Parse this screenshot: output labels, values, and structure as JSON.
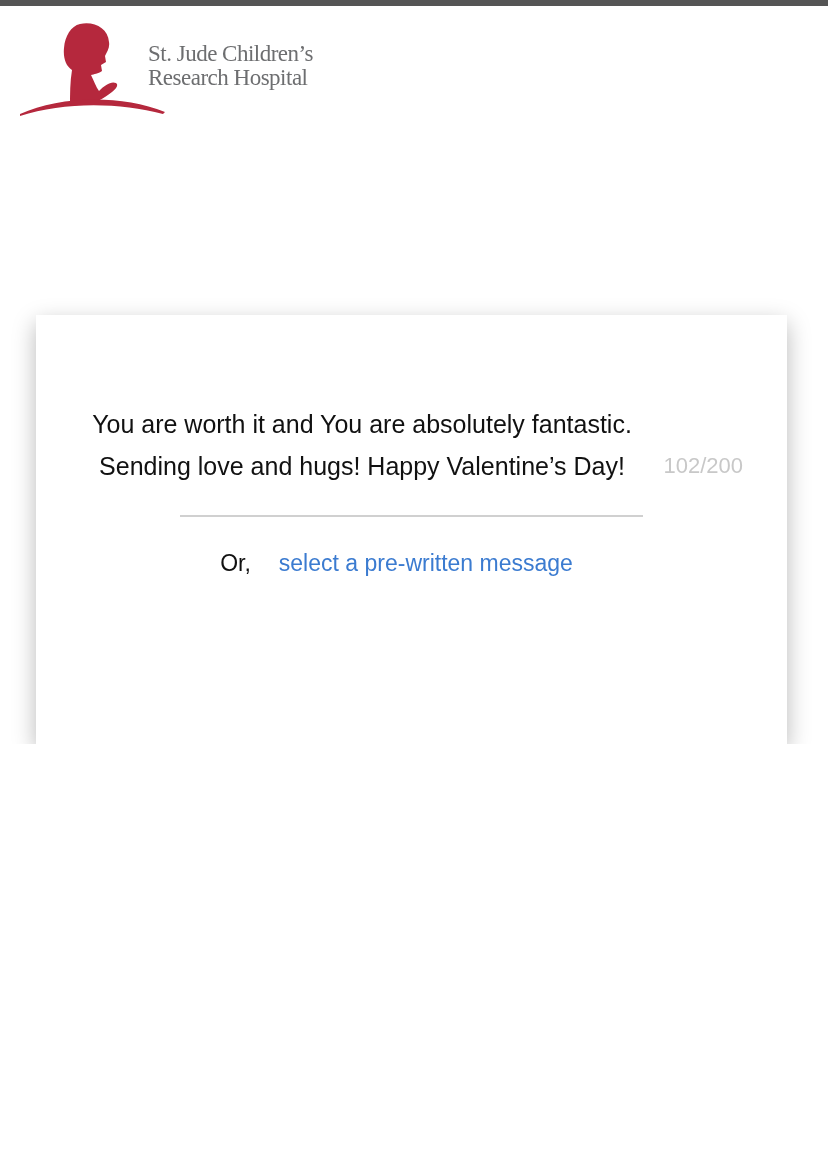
{
  "logo": {
    "line_1": "St. Jude Children’s",
    "line_2": "Research Hospital"
  },
  "message": {
    "value": "You are worth it and You are absolutely fantastic. Sending love and hugs! Happy Valentine’s Day!",
    "counter": "102/200"
  },
  "alternative": {
    "prefix": "Or,",
    "link": "select a pre-written message"
  }
}
